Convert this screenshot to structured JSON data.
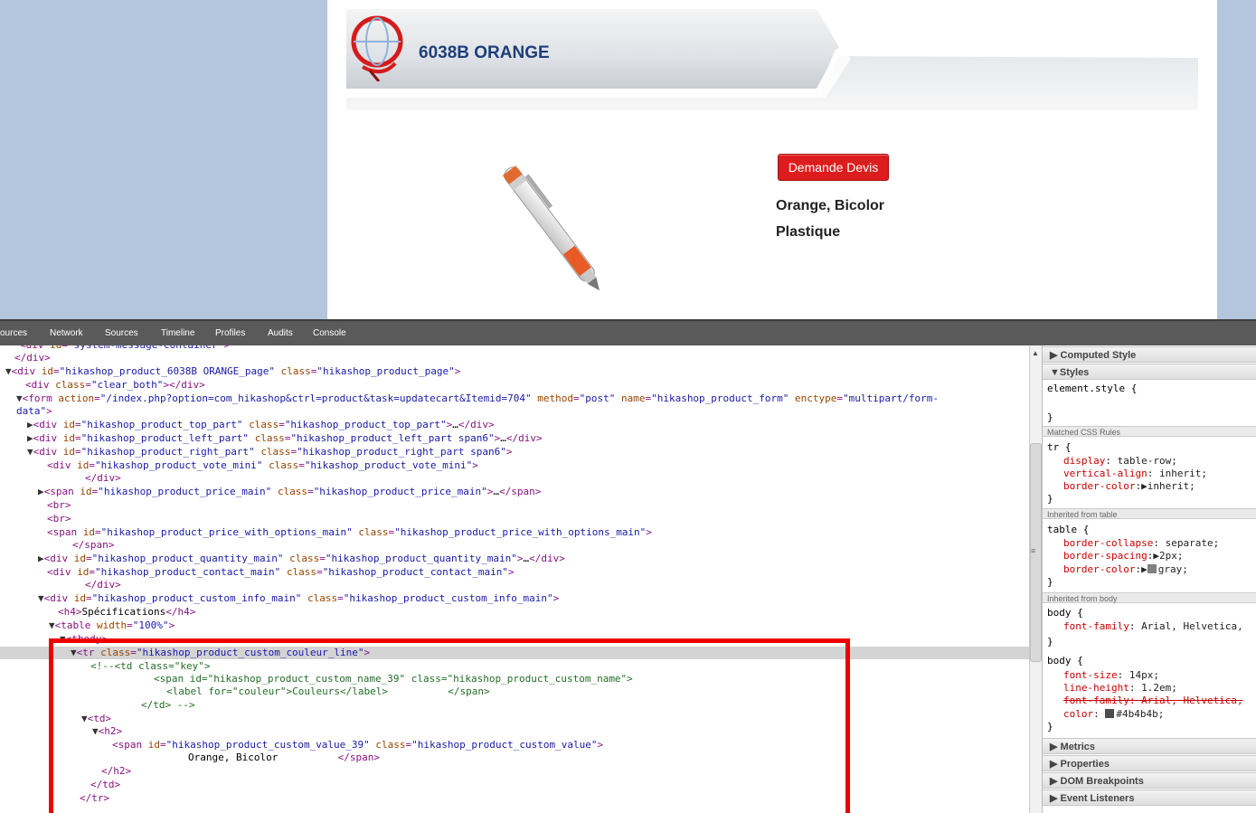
{
  "website": {
    "product_title": "6038B ORANGE",
    "quote_button": "Demande Devis",
    "attr_color": "Orange, Bicolor",
    "attr_material": "Plastique"
  },
  "devtools": {
    "tabs": [
      "ources",
      "Network",
      "Sources",
      "Timeline",
      "Profiles",
      "Audits",
      "Console"
    ],
    "sidebar": {
      "computed_style": "Computed Style",
      "styles": "Styles",
      "element_style": "element.style {",
      "close_brace": "}",
      "matched_rules": "Matched CSS Rules",
      "inherited_table": "Inherited from table",
      "inherited_body": "Inherited from body",
      "tr_selector": "tr {",
      "tr_display_name": "display",
      "tr_display_val": "table-row;",
      "tr_valign_name": "vertical-align",
      "tr_valign_val": "inherit;",
      "tr_bcolor_name": "border-color",
      "tr_bcolor_val": "inherit;",
      "table_selector": "table {",
      "table_collapse_name": "border-collapse",
      "table_collapse_val": "separate;",
      "table_spacing_name": "border-spacing",
      "table_spacing_val": "2px;",
      "table_bcolor_name": "border-color",
      "table_bcolor_val": "gray;",
      "body_selector": "body {",
      "body_font_name": "font-family",
      "body_font_val": "Arial, Helvetica,",
      "body2_size_name": "font-size",
      "body2_size_val": "14px;",
      "body2_lh_name": "line-height",
      "body2_lh_val": "1.2em;",
      "body2_font_strike": "font-family: Arial, Helvetica,",
      "body2_color_name": "color",
      "body2_color_val": "#4b4b4b;",
      "metrics": "Metrics",
      "properties": "Properties",
      "dom_breakpoints": "DOM Breakpoints",
      "event_listeners": "Event Listeners"
    },
    "colors": {
      "gray_swatch": "#808080",
      "text_swatch": "#4b4b4b",
      "highlight": "#ee0000"
    }
  }
}
